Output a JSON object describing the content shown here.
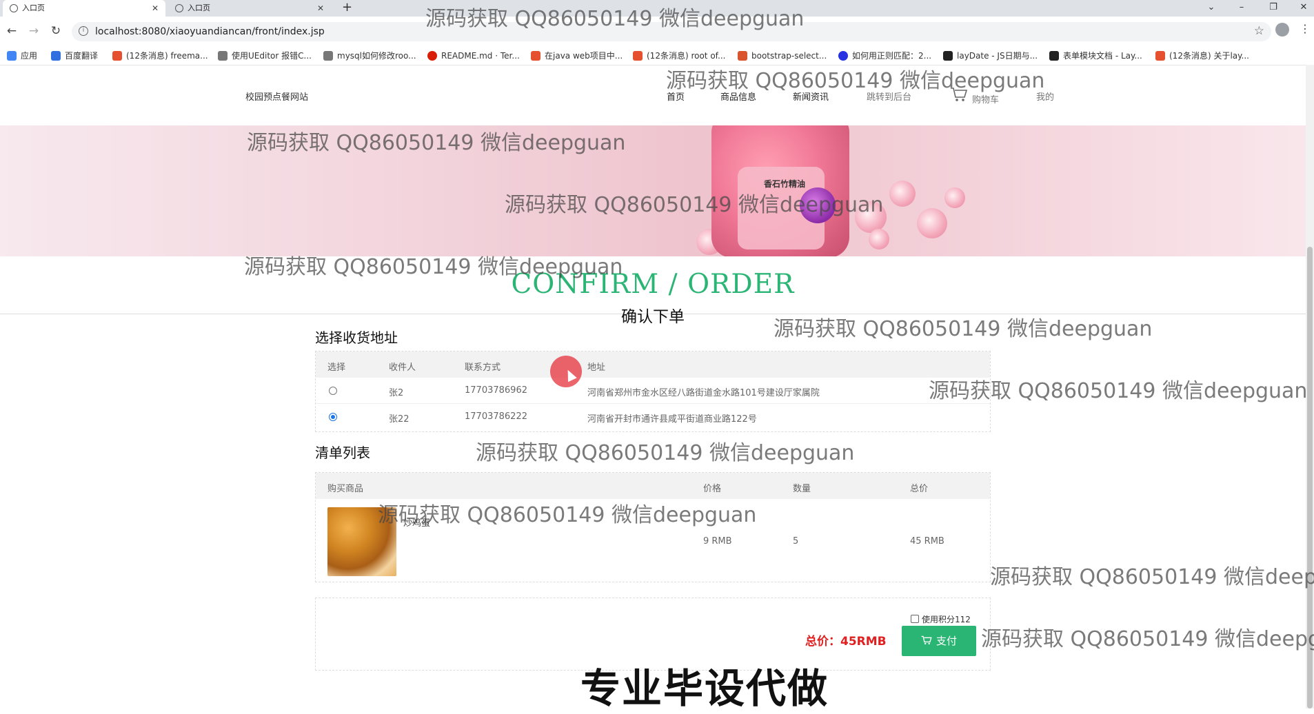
{
  "browser": {
    "tabs": [
      {
        "title": "入口页",
        "close": "✕"
      },
      {
        "title": "入口页",
        "close": "✕"
      }
    ],
    "new_tab": "+",
    "window_controls": {
      "menu": "⌄",
      "minimize": "–",
      "restore": "❐",
      "close": "✕"
    },
    "nav": {
      "back": "←",
      "forward": "→",
      "reload": "↻"
    },
    "url": "localhost:8080/xiaoyuandiancan/front/index.jsp",
    "info": "i",
    "bookmark_star": "☆",
    "kebab": "⋮",
    "bookmarks": [
      {
        "label": "应用",
        "color": "#4285f4"
      },
      {
        "label": "百度翻译",
        "color": "#2f6fe0"
      },
      {
        "label": "(12条消息) freema...",
        "color": "#e5502e"
      },
      {
        "label": "使用UEditor 报错C...",
        "color": "#555"
      },
      {
        "label": "mysql如何修改roo...",
        "color": "#555"
      },
      {
        "label": "README.md · Ter...",
        "color": "#d81e06"
      },
      {
        "label": "在java web项目中...",
        "color": "#e5502e"
      },
      {
        "label": "(12条消息) root of...",
        "color": "#e5502e"
      },
      {
        "label": "bootstrap-select...",
        "color": "#d9532c"
      },
      {
        "label": "如何用正则匹配：2...",
        "color": "#2932e1"
      },
      {
        "label": "layDate - JS日期与...",
        "color": "#222"
      },
      {
        "label": "表单模块文档 - Lay...",
        "color": "#222"
      },
      {
        "label": "(12条消息) 关于lay...",
        "color": "#e5502e"
      }
    ]
  },
  "site": {
    "name": "校园预点餐网站",
    "nav": [
      "首页",
      "商品信息",
      "新闻资讯",
      "跳转到后台",
      "购物车",
      "我的"
    ],
    "banner_text": "香石竹精油"
  },
  "page": {
    "title_en": "CONFIRM / ORDER",
    "title_cn": "确认下单"
  },
  "address": {
    "heading": "选择收货地址",
    "columns": [
      "选择",
      "收件人",
      "联系方式",
      "地址"
    ],
    "rows": [
      {
        "name": "张2",
        "phone": "17703786962",
        "address": "河南省郑州市金水区经八路街道金水路101号建设厅家属院",
        "selected": false
      },
      {
        "name": "张22",
        "phone": "17703786222",
        "address": "河南省开封市通许县咸平街道商业路122号",
        "selected": true
      }
    ]
  },
  "list": {
    "heading": "清单列表",
    "columns": [
      "购买商品",
      "价格",
      "数量",
      "总价"
    ],
    "items": [
      {
        "name": "炒鸡蛋",
        "price": "9 RMB",
        "qty": "5",
        "total": "45 RMB"
      }
    ]
  },
  "checkout": {
    "points_label": "使用积分112",
    "points_checked": false,
    "total_label": "总价：45RMB",
    "pay_label": "支付",
    "pay_icon": "cart-icon"
  },
  "overlay": {
    "watermark": "源码获取 QQ86050149 微信deepguan",
    "watermark_cut": "源码获取 QQ86050149 微信deepg",
    "big_text": "专业毕设代做"
  }
}
